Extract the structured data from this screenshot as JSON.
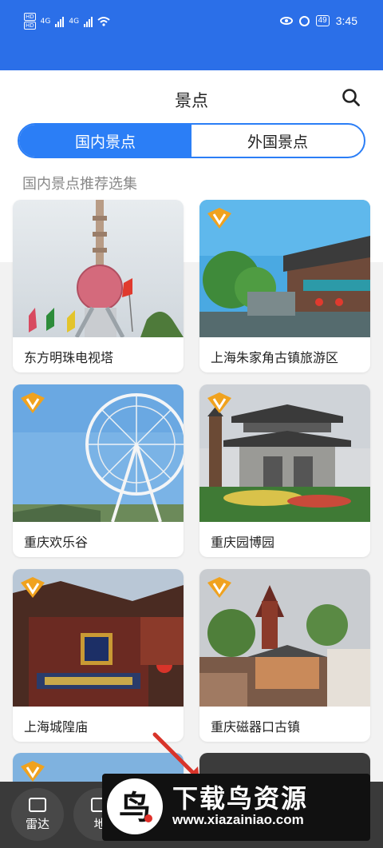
{
  "status_bar": {
    "hd1": "HD",
    "hd2": "HD",
    "net1": "4G",
    "net2": "4G",
    "battery": "49",
    "time": "3:45"
  },
  "header": {
    "title": "景点",
    "search_icon": "search-icon"
  },
  "tabs": [
    {
      "label": "国内景点",
      "active": true
    },
    {
      "label": "外国景点",
      "active": false
    }
  ],
  "section_title": "国内景点推荐选集",
  "cards": [
    {
      "name": "东方明珠电视塔",
      "vip": false
    },
    {
      "name": "上海朱家角古镇旅游区",
      "vip": true
    },
    {
      "name": "重庆欢乐谷",
      "vip": true
    },
    {
      "name": "重庆园博园",
      "vip": true
    },
    {
      "name": "上海城隍庙",
      "vip": true
    },
    {
      "name": "重庆磁器口古镇",
      "vip": true
    }
  ],
  "bottom_nav": [
    {
      "label": "雷达",
      "icon": "map-icon"
    },
    {
      "label": "地",
      "icon": "map-icon"
    }
  ],
  "watermark": {
    "title": "下载鸟资源",
    "url": "www.xiazainiao.com",
    "logo_letter": "鸟"
  },
  "colors": {
    "accent": "#2b7ef6",
    "status_bar": "#2b6fe8",
    "vip_badge": "#f0a21e"
  }
}
